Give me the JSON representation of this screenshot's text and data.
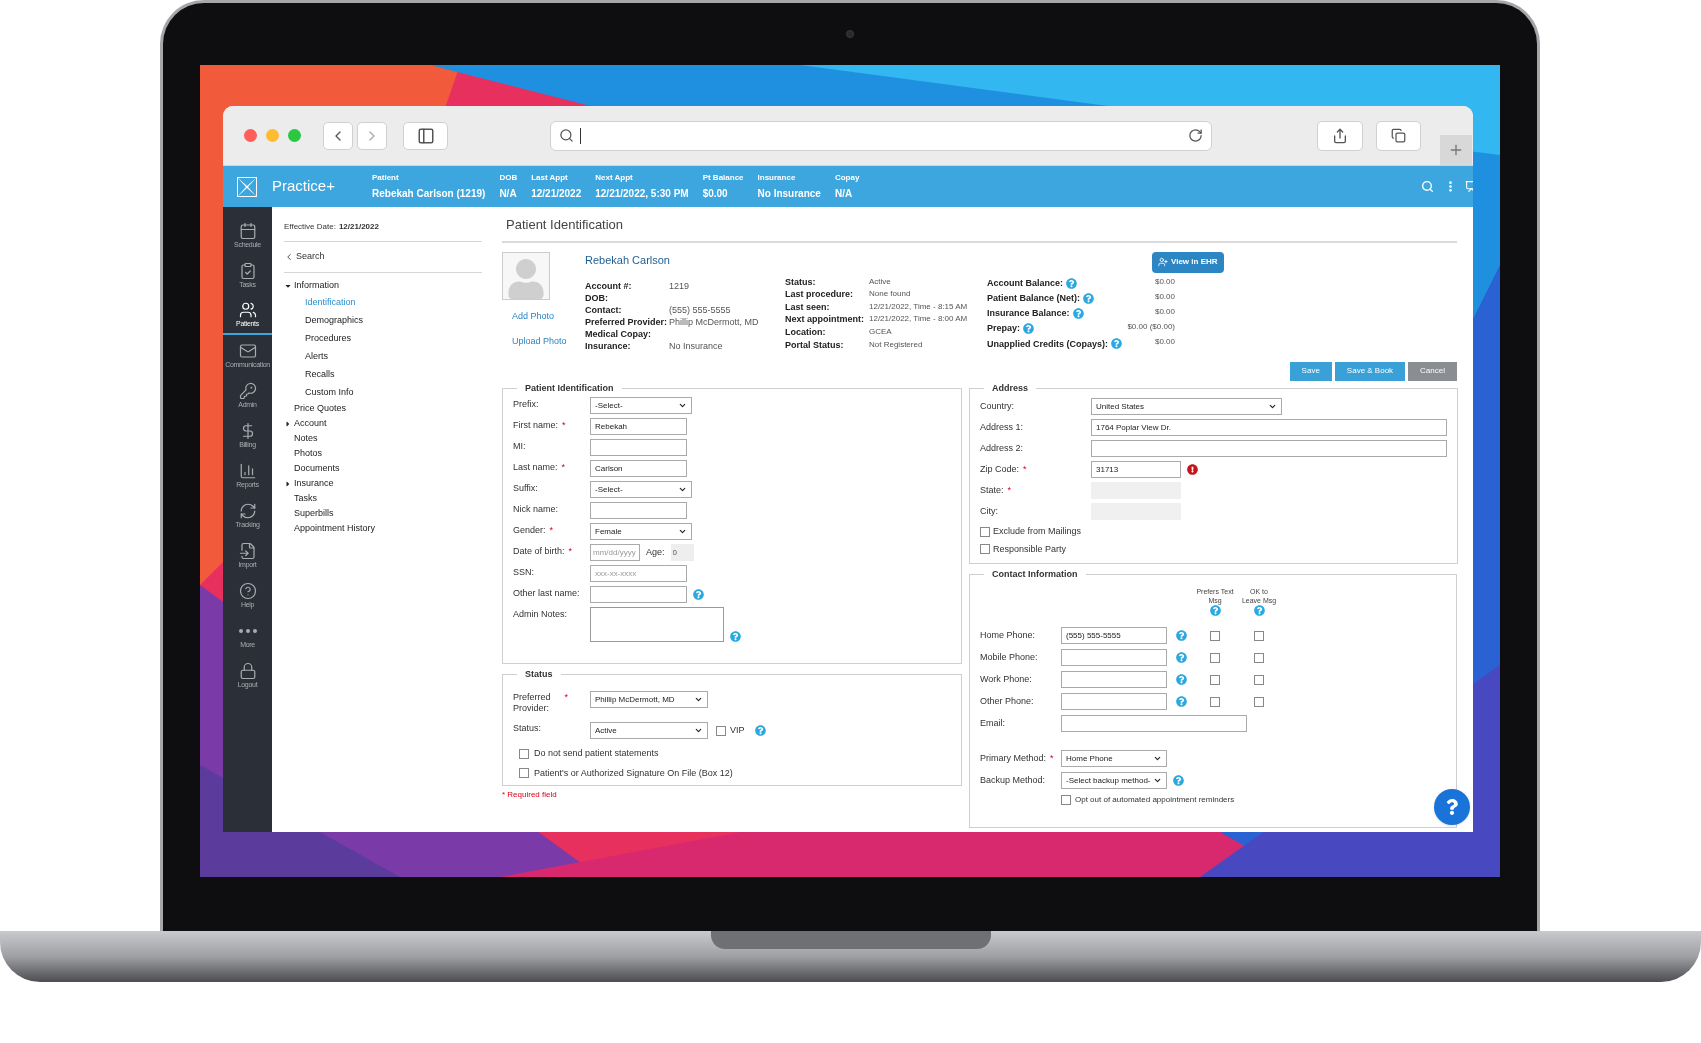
{
  "app": {
    "name": "Practice+"
  },
  "header_fields": [
    {
      "label": "Patient",
      "value": "Rebekah Carlson (1219)"
    },
    {
      "label": "DOB",
      "value": "N/A"
    },
    {
      "label": "Last Appt",
      "value": "12/21/2022"
    },
    {
      "label": "Next Appt",
      "value": "12/21/2022, 5:30 PM"
    },
    {
      "label": "Pt Balance",
      "value": "$0.00"
    },
    {
      "label": "Insurance",
      "value": "No Insurance"
    },
    {
      "label": "Copay",
      "value": "N/A"
    }
  ],
  "rail": [
    {
      "label": "Schedule",
      "selected": false
    },
    {
      "label": "Tasks",
      "selected": false
    },
    {
      "label": "Patients",
      "selected": true
    },
    {
      "label": "Communication",
      "selected": false
    },
    {
      "label": "Admin",
      "selected": false
    },
    {
      "label": "Billing",
      "selected": false
    },
    {
      "label": "Reports",
      "selected": false
    },
    {
      "label": "Tracking",
      "selected": false
    },
    {
      "label": "Import",
      "selected": false
    },
    {
      "label": "Help",
      "selected": false
    },
    {
      "label": "More",
      "selected": false
    },
    {
      "label": "Logout",
      "selected": false
    }
  ],
  "subnav": {
    "effective_label": "Effective Date:",
    "effective_date": "12/21/2022",
    "back": "Search",
    "tree": [
      {
        "label": "Information",
        "expanded": true,
        "selected": false,
        "children": [
          {
            "label": "Identification",
            "selected": true
          },
          {
            "label": "Demographics",
            "selected": false
          },
          {
            "label": "Procedures",
            "selected": false
          },
          {
            "label": "Alerts",
            "selected": false
          },
          {
            "label": "Recalls",
            "selected": false
          },
          {
            "label": "Custom Info",
            "selected": false
          }
        ]
      },
      {
        "label": "Price Quotes",
        "selected": false
      },
      {
        "label": "Account",
        "expanded": false,
        "selected": false
      },
      {
        "label": "Notes",
        "selected": false
      },
      {
        "label": "Photos",
        "selected": false
      },
      {
        "label": "Documents",
        "selected": false
      },
      {
        "label": "Insurance",
        "expanded": false,
        "selected": false
      },
      {
        "label": "Tasks",
        "selected": false
      },
      {
        "label": "Superbills",
        "selected": false
      },
      {
        "label": "Appointment History",
        "selected": false
      }
    ]
  },
  "page_title": "Patient Identification",
  "patient": {
    "name": "Rebekah Carlson",
    "photo_links": [
      "Add Photo",
      "Upload Photo"
    ],
    "ehr_button": "View in EHR",
    "details": [
      {
        "label": "Account #:",
        "value": "1219"
      },
      {
        "label": "DOB:"
      },
      {
        "label": "Contact:",
        "value": "(555) 555-5555"
      },
      {
        "label": "Preferred Provider:",
        "value": "Phillip McDermott, MD"
      },
      {
        "label": "Medical Copay:"
      },
      {
        "label": "Insurance:",
        "value": "No Insurance"
      }
    ],
    "status": [
      {
        "label": "Status:",
        "value": "Active"
      },
      {
        "label": "Last procedure:",
        "value": "None found"
      },
      {
        "label": "Last seen:",
        "value": "12/21/2022, Time - 8:15 AM"
      },
      {
        "label": "Next appointment:",
        "value": "12/21/2022, Time - 8:00 AM"
      },
      {
        "label": "Location:",
        "value": "GCEA"
      },
      {
        "label": "Portal Status:",
        "value": "Not Registered"
      }
    ],
    "balances": [
      {
        "label": "Account Balance:",
        "value": "$0.00",
        "help": true
      },
      {
        "label": "Patient Balance (Net):",
        "value": "$0.00",
        "help": true
      },
      {
        "label": "Insurance Balance:",
        "value": "$0.00",
        "help": true
      },
      {
        "label": "Prepay:",
        "value": "$0.00 ($0.00)",
        "help": true
      },
      {
        "label": "Unapplied Credits (Copays):",
        "value": "$0.00",
        "help": true
      }
    ]
  },
  "actions": [
    {
      "label": "Save",
      "kind": "primary"
    },
    {
      "label": "Save & Book",
      "kind": "primary"
    },
    {
      "label": "Cancel",
      "kind": "secondary"
    }
  ],
  "required_mark": "*",
  "identification": {
    "legend": "Patient Identification",
    "fields": [
      {
        "label": "Prefix:",
        "kind": "select",
        "value": "-Select-",
        "required": false,
        "help": false
      },
      {
        "label": "First name:",
        "kind": "text",
        "value": "Rebekah",
        "required": true,
        "help": false
      },
      {
        "label": "MI:",
        "kind": "text",
        "required": false,
        "help": false
      },
      {
        "label": "Last name:",
        "kind": "text",
        "value": "Carlson",
        "required": true,
        "help": false
      },
      {
        "label": "Suffix:",
        "kind": "select",
        "value": "-Select-",
        "required": false,
        "help": false
      },
      {
        "label": "Nick name:",
        "kind": "text",
        "required": false,
        "help": false
      },
      {
        "label": "Gender:",
        "kind": "select",
        "value": "Female",
        "required": true,
        "help": false
      },
      {
        "label": "Date of birth:",
        "kind": "date",
        "placeholder": "mm/dd/yyyy",
        "age_label": "Age:",
        "age": "0",
        "required": true,
        "help": false
      },
      {
        "label": "SSN:",
        "kind": "text",
        "placeholder": "xxx-xx-xxxx",
        "required": false,
        "help": false
      },
      {
        "label": "Other last name:",
        "kind": "text",
        "required": false,
        "help": true
      },
      {
        "label": "Admin Notes:",
        "kind": "textarea",
        "required": false,
        "help": true
      }
    ]
  },
  "status_section": {
    "legend": "Status",
    "fields": [
      {
        "label": "Preferred Provider:",
        "kind": "select",
        "value": "Phillip McDermott, MD",
        "required": true,
        "help": false
      },
      {
        "label": "Status:",
        "kind": "select",
        "value": "Active",
        "required": false,
        "help": true,
        "vip": {
          "label": "VIP",
          "checked": false
        }
      }
    ],
    "checks": [
      {
        "label": "Do not send patient statements",
        "checked": false
      },
      {
        "label": "Patient's or Authorized Signature On File (Box 12)",
        "checked": false
      }
    ]
  },
  "required_note": "* Required field",
  "address": {
    "legend": "Address",
    "fields": [
      {
        "label": "Country:",
        "kind": "select",
        "value": "United States",
        "required": false,
        "error": false
      },
      {
        "label": "Address 1:",
        "kind": "text",
        "value": "1764 Poplar View Dr.",
        "required": false,
        "error": false
      },
      {
        "label": "Address 2:",
        "kind": "text",
        "required": false,
        "error": false
      },
      {
        "label": "Zip Code:",
        "kind": "text",
        "value": "31713",
        "required": true,
        "error": true
      },
      {
        "label": "State:",
        "kind": "locked",
        "required": true,
        "error": false
      },
      {
        "label": "City:",
        "kind": "locked",
        "required": false,
        "error": false
      }
    ],
    "checks": [
      {
        "label": "Exclude from Mailings",
        "checked": false
      },
      {
        "label": "Responsible Party",
        "checked": false
      }
    ]
  },
  "contact": {
    "legend": "Contact Information",
    "columns": [
      {
        "label": "Prefers Text Msg",
        "help": true
      },
      {
        "label": "OK to Leave Msg",
        "help": true
      }
    ],
    "phones": [
      {
        "label": "Home Phone:",
        "value": "(555) 555-5555",
        "help": true,
        "prefers_text": false,
        "ok_to_leave": false
      },
      {
        "label": "Mobile Phone:",
        "help": true,
        "prefers_text": false,
        "ok_to_leave": false
      },
      {
        "label": "Work Phone:",
        "help": true,
        "prefers_text": false,
        "ok_to_leave": false
      },
      {
        "label": "Other Phone:",
        "help": true,
        "prefers_text": false,
        "ok_to_leave": false
      }
    ],
    "email": {
      "label": "Email:"
    },
    "methods": [
      {
        "label": "Primary Method:",
        "kind": "select",
        "value": "Home Phone",
        "required": true,
        "help": false
      },
      {
        "label": "Backup Method:",
        "kind": "select",
        "value": "-Select backup method-",
        "required": false,
        "help": true
      }
    ],
    "opt_out": {
      "label": "Opt out of automated appointment reminders",
      "checked": false
    }
  }
}
